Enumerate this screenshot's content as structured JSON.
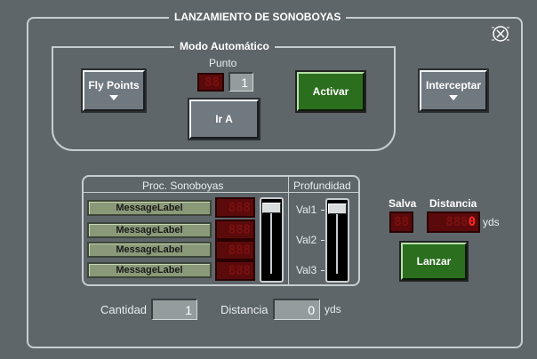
{
  "window": {
    "title": "LANZAMIENTO DE SONOBOYAS",
    "close_icon": "close-circle-icon"
  },
  "modo": {
    "title": "Modo Automático",
    "fly_points_label": "Fly Points",
    "punto_label": "Punto",
    "punto_led": "88",
    "punto_value": "1",
    "ir_a_label": "Ir A",
    "activar_label": "Activar"
  },
  "interceptar_label": "Interceptar",
  "proc": {
    "title": "Proc. Sonoboyas",
    "rows": [
      {
        "label": "MessageLabel",
        "led": "888"
      },
      {
        "label": "MessageLabel",
        "led": "888"
      },
      {
        "label": "MessageLabel",
        "led": "888"
      },
      {
        "label": "MessageLabel",
        "led": "888"
      }
    ]
  },
  "profundidad": {
    "title": "Profundidad",
    "val1": "Val1",
    "val2": "Val2",
    "val3": "Val3"
  },
  "salva": {
    "label": "Salva",
    "led": "88"
  },
  "distancia_led": {
    "label": "Distancia",
    "led_dim": "888",
    "led_value": "0",
    "unit": "yds"
  },
  "lanzar_label": "Lanzar",
  "cantidad": {
    "label": "Cantidad",
    "value": "1"
  },
  "distancia": {
    "label": "Distancia",
    "value": "0",
    "unit": "yds"
  },
  "colors": {
    "background": "#5f666a",
    "green_button": "#2b6e1e",
    "led_red": "#ff2a2a"
  }
}
